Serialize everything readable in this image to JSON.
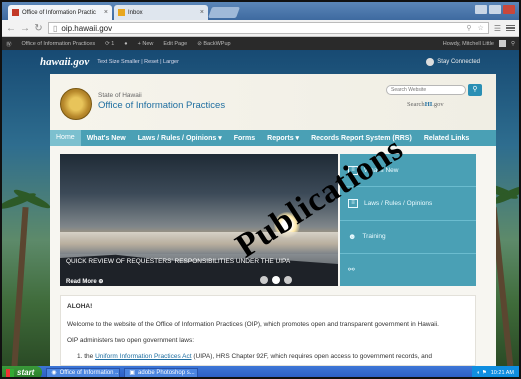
{
  "browser": {
    "tabs": [
      {
        "label": "Office of Information Practic"
      },
      {
        "label": "Inbox"
      }
    ],
    "url": "oip.hawaii.gov"
  },
  "admin_bar": {
    "site": "Office of Information Practices",
    "comments": "1",
    "new": "+ New",
    "edit": "Edit Page",
    "bsb": "BackWPup",
    "howdy": "Howdy, Mitchell Little"
  },
  "site_bar": {
    "logo": "hawaii.gov",
    "text_size": "Text Size  Smaller | Reset | Larger",
    "stay_connected": "Stay Connected"
  },
  "header": {
    "state": "State of Hawaii",
    "office": "Office of Information Practices",
    "search_placeholder": "Search Website",
    "search_hi": "Search",
    "search_hi_suffix": ".gov"
  },
  "nav": {
    "items": [
      "Home",
      "What's New",
      "Laws / Rules / Opinions ▾",
      "Forms",
      "Reports ▾",
      "Records Report System (RRS)",
      "Related Links"
    ]
  },
  "slider": {
    "caption": "QUICK REVIEW OF REQUESTERS' RESPONSIBILITIES UNDER THE UIPA",
    "read_more": "Read More"
  },
  "quick_links": [
    {
      "label": "What's New",
      "icon": "newspaper-icon"
    },
    {
      "label": "Laws / Rules / Opinions",
      "icon": "document-icon"
    },
    {
      "label": "Training",
      "icon": "people-icon"
    },
    {
      "label": "",
      "icon": "link-icon"
    }
  ],
  "aloha": {
    "heading": "ALOHA!",
    "welcome": "Welcome to the website of the Office of Information Practices (OIP), which promotes open and transparent government in Hawaii.",
    "administers": "OIP administers two open government laws:",
    "law1_num": "1.",
    "law1_link": "Uniform Information Practices Act",
    "law1_rest": "(UIPA), HRS Chapter 92F, which requires open access to government records, and"
  },
  "overlay_text": "Publications",
  "taskbar": {
    "start": "start",
    "tasks": [
      "Office of Information ...",
      "adobe Photoshop s..."
    ],
    "time": "10:21 AM"
  }
}
